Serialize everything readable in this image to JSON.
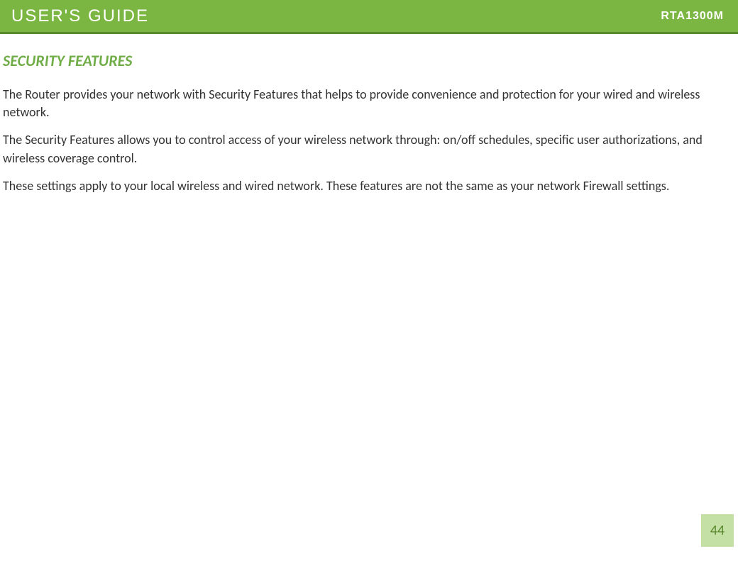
{
  "header": {
    "title": "USER'S GUIDE",
    "model": "RTA1300M"
  },
  "section": {
    "heading": "SECURITY FEATURES",
    "paragraphs": [
      "The Router provides your network with Security Features that helps to provide convenience and protection for your wired and wireless network.",
      "The Security Features allows you to control access of your wireless network through: on/off schedules, specific user authorizations, and wireless coverage control.",
      "These settings apply to your local wireless and wired network.  These features are not the same as your network Firewall settings."
    ]
  },
  "page_number": "44"
}
